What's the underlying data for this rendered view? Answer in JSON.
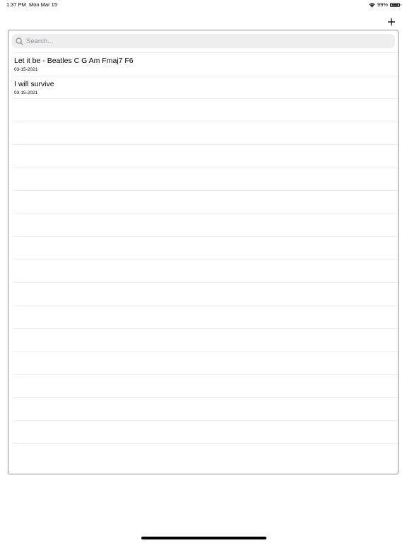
{
  "status_bar": {
    "time": "1:37 PM",
    "date": "Mon Mar 15",
    "battery": "99%",
    "battery_level": 0.99,
    "icons": [
      "wifi-icon",
      "battery-icon"
    ]
  },
  "toolbar": {
    "add_icon": "plus-icon"
  },
  "search": {
    "placeholder": "Search...",
    "value": "",
    "icon": "search-icon"
  },
  "songs": [
    {
      "title": "Let it be - Beatles C G Am Fmaj7 F6",
      "date": "03-15-2021"
    },
    {
      "title": "I will survive",
      "date": "03-15-2021"
    }
  ],
  "empty_row_count": 16
}
